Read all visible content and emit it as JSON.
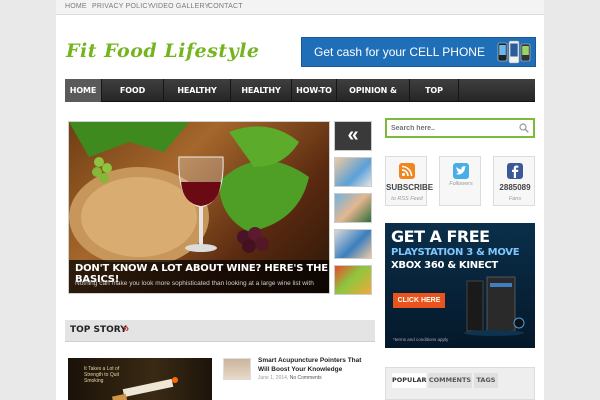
{
  "topbar": {
    "links": [
      "HOME",
      "PRIVACY POLICY",
      "VIDEO GALLERY",
      "CONTACT"
    ]
  },
  "header": {
    "logo_text": "Fit Food Lifestyle",
    "ad_text": "Get cash for your CELL PHONE"
  },
  "nav": {
    "items": [
      "HOME",
      "FOOD RECALLS",
      "HEALTHY RECIPE",
      "HEALTHY TIPS",
      "HOW-TO",
      "OPINION & REVIEW",
      "TOP STORY"
    ],
    "active_index": 0
  },
  "slider": {
    "title": "DON'T KNOW A LOT ABOUT WINE? HERE'S THE BASICS!",
    "excerpt": "Nothing can make you look more sophisticated than looking at a large wine list with",
    "prev_symbol": "«"
  },
  "search": {
    "placeholder": "Search here.."
  },
  "social": [
    {
      "icon": "rss-icon",
      "count": "SUBSCRIBE",
      "label": "to RSS Feed",
      "color": "#f0861d"
    },
    {
      "icon": "twitter-icon",
      "count": "",
      "label": "Followers",
      "color": "#4aaee6"
    },
    {
      "icon": "facebook-icon",
      "count": "2885089",
      "label": "Fans",
      "color": "#3b5998"
    }
  ],
  "promo": {
    "line1": "GET A FREE",
    "line2": "PLAYSTATION 3 & MOVE",
    "line3": "XBOX 360 & KINECT",
    "button": "CLICK HERE",
    "fine_print": "*terms and conditions apply"
  },
  "top_story": {
    "heading": "TOP STORY",
    "chevron": "»",
    "feature_caption": "It Takes a Lot of Strength to Quit Smoking",
    "post": {
      "title": "Smart Acupuncture Pointers That Will Boost Your Knowledge",
      "date": "June 1, 2014,",
      "comments": "No Comments"
    }
  },
  "sidebar_tabs": [
    "POPULAR",
    "COMMENTS",
    "TAGS"
  ]
}
